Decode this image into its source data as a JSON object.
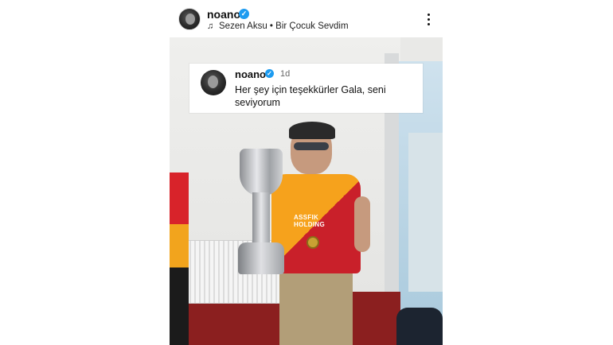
{
  "post": {
    "username": "noano",
    "verified_symbol": "✓",
    "music_icon": "music-note-icon",
    "music": "Sezen Aksu • Bir Çocuk Sevdim"
  },
  "comment": {
    "username": "noano",
    "verified_symbol": "✓",
    "time": "1d",
    "text": "Her şey için teşekkürler Gala, seni seviyorum"
  },
  "photo": {
    "jersey_sponsor": "ASSFIK HOLDING"
  },
  "colors": {
    "verified": "#1d9bf0",
    "jersey_yellow": "#f6a21c",
    "jersey_red": "#c9202a"
  }
}
